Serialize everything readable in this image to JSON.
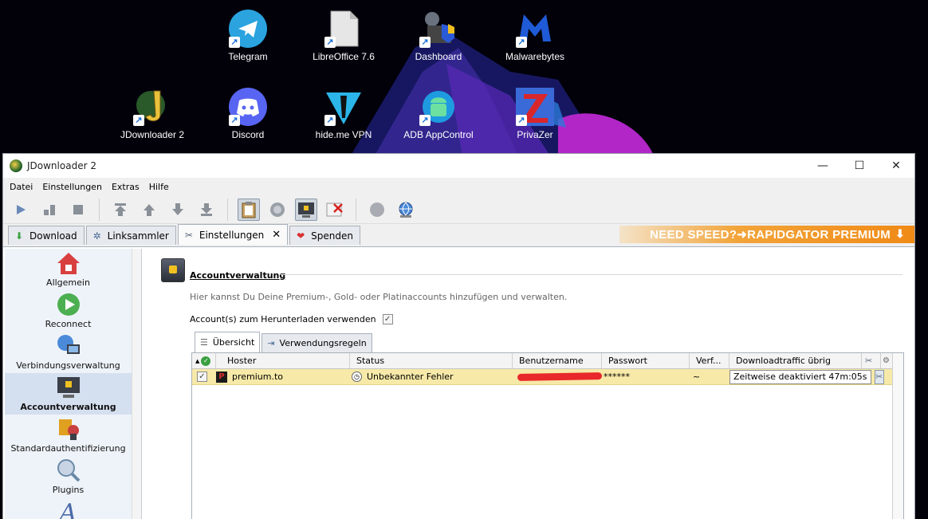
{
  "desktop": {
    "icons": [
      {
        "label": "Telegram",
        "icon": "telegram-icon",
        "color": "#2aa3df"
      },
      {
        "label": "LibreOffice 7.6",
        "icon": "libreoffice-icon",
        "color": "#e6e6e6"
      },
      {
        "label": "Dashboard",
        "icon": "dashboard-icon",
        "color": "#6a7280"
      },
      {
        "label": "Malwarebytes",
        "icon": "malwarebytes-icon",
        "color": "#1f5bd6"
      },
      {
        "label": "JDownloader 2",
        "icon": "jdownloader-icon",
        "color": "#e9c23b"
      },
      {
        "label": "Discord",
        "icon": "discord-icon",
        "color": "#5865f2"
      },
      {
        "label": "hide.me VPN",
        "icon": "hideme-vpn-icon",
        "color": "#2bb5e8"
      },
      {
        "label": "ADB AppControl",
        "icon": "adb-appcontrol-icon",
        "color": "#1e9be0"
      },
      {
        "label": "PrivaZer",
        "icon": "privazer-icon",
        "color": "#d8262b"
      }
    ]
  },
  "window": {
    "title": "JDownloader 2",
    "controls": {
      "minimize": "—",
      "maximize": "☐",
      "close": "✕"
    }
  },
  "menu": [
    "Datei",
    "Einstellungen",
    "Extras",
    "Hilfe"
  ],
  "tabs": [
    {
      "label": "Download",
      "icon": "download-arrow-icon",
      "active": false
    },
    {
      "label": "Linksammler",
      "icon": "linkgrabber-icon",
      "active": false
    },
    {
      "label": "Einstellungen",
      "icon": "tools-icon",
      "active": true,
      "close": "✕"
    },
    {
      "label": "Spenden",
      "icon": "heart-icon",
      "active": false
    }
  ],
  "banner": {
    "text": "NEED SPEED?➜RAPIDGATOR PREMIUM"
  },
  "sidebar": {
    "items": [
      {
        "label": "Allgemein",
        "icon": "house-icon",
        "color": "#d84040"
      },
      {
        "label": "Reconnect",
        "icon": "reconnect-icon",
        "color": "#4caf50"
      },
      {
        "label": "Verbindungsverwaltung",
        "icon": "network-icon",
        "color": "#4a8ad8"
      },
      {
        "label": "Accountverwaltung",
        "icon": "account-monitor-icon",
        "color": "#3a3f48",
        "active": true
      },
      {
        "label": "Standardauthentifizierung",
        "icon": "auth-icon",
        "color": "#e0a020"
      },
      {
        "label": "Plugins",
        "icon": "plugins-icon",
        "color": "#6a8aa8"
      }
    ]
  },
  "panel": {
    "title": "Accountverwaltung",
    "description": "Hier kannst Du Deine Premium-, Gold- oder Platinaccounts hinzufügen und verwalten.",
    "use_accounts_label": "Account(s) zum Herunterladen verwenden",
    "check": "✓",
    "subtabs": [
      {
        "label": "Übersicht",
        "active": true
      },
      {
        "label": "Verwendungsregeln",
        "active": false
      }
    ]
  },
  "table": {
    "headers": {
      "sort": "▲",
      "hoster": "Hoster",
      "status": "Status",
      "user": "Benutzername",
      "password": "Passwort",
      "verf": "Verf...",
      "traffic": "Downloadtraffic übrig"
    },
    "rows": [
      {
        "hoster": "premium.to",
        "hoster_badge": "P",
        "status": "Unbekannter Fehler",
        "password": "******",
        "verf": "~",
        "traffic": "Zeitweise deaktiviert 47m:05s"
      }
    ]
  },
  "colors": {
    "accent_row": "#f7e9a8",
    "banner": "#f08a16"
  }
}
